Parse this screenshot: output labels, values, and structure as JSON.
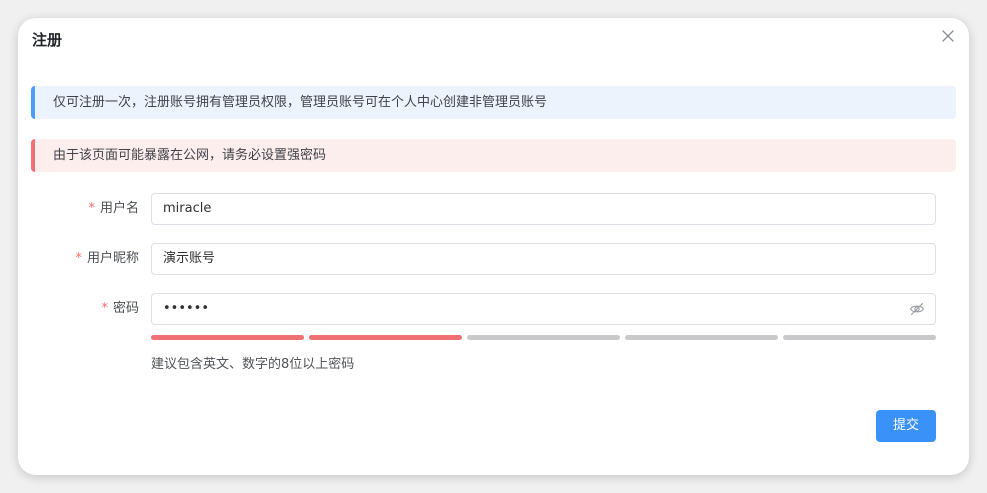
{
  "dialog": {
    "title": "注册",
    "close_icon": "close-icon"
  },
  "alerts": {
    "info": "仅可注册一次，注册账号拥有管理员权限，管理员账号可在个人中心创建非管理员账号",
    "warning": "由于该页面可能暴露在公网，请务必设置强密码"
  },
  "form": {
    "username": {
      "label": "用户名",
      "required_mark": "*",
      "value": "miracle"
    },
    "nickname": {
      "label": "用户昵称",
      "required_mark": "*",
      "value": "演示账号"
    },
    "password": {
      "label": "密码",
      "required_mark": "*",
      "value": "••••••",
      "toggle_icon": "eye-hidden-icon"
    },
    "strength": {
      "total_levels": 5,
      "filled_levels": 2,
      "filled_color": "#f07173",
      "empty_color": "#c9c9cc"
    },
    "hint": "建议包含英文、数字的8位以上密码",
    "submit_label": "提交"
  },
  "colors": {
    "primary": "#3a92f8",
    "info_bar": "#4a9df8",
    "danger": "#f07173"
  }
}
